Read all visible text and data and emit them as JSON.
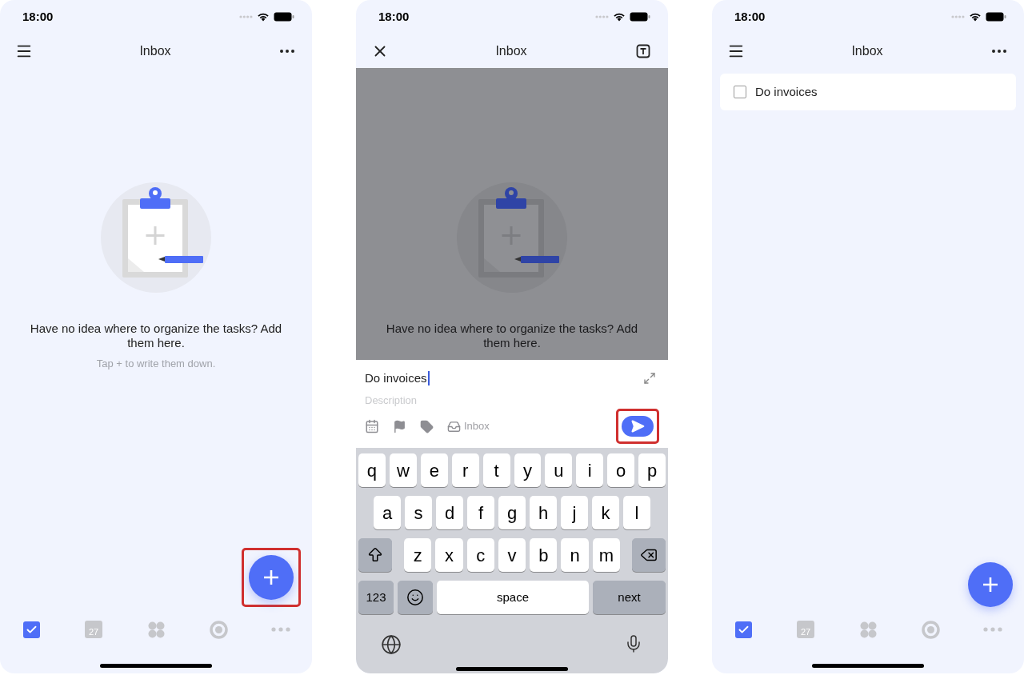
{
  "screens": [
    {
      "kind": "empty",
      "status_time": "18:00",
      "nav": {
        "left": {
          "kind": "menu"
        },
        "title": "Inbox",
        "right": {
          "kind": "more"
        }
      },
      "empty_state": {
        "message": "Have no idea where to organize the tasks? Add them here.",
        "hint": "Tap + to write them down."
      },
      "fab": {
        "highlighted": true
      },
      "tab_bar": [
        {
          "kind": "tasks",
          "selected": true
        },
        {
          "kind": "calendar",
          "label": "27",
          "selected": false
        },
        {
          "kind": "grid",
          "selected": false
        },
        {
          "kind": "focus",
          "selected": false
        },
        {
          "kind": "more",
          "selected": false
        }
      ]
    },
    {
      "kind": "compose",
      "status_time": "18:00",
      "nav": {
        "left": {
          "kind": "close"
        },
        "title": "Inbox",
        "right": {
          "kind": "template"
        }
      },
      "dimmed": true,
      "empty_state": {
        "message": "Have no idea where to organize the tasks? Add them here."
      },
      "compose": {
        "title": "Do invoices",
        "description_placeholder": "Description",
        "list_label": "Inbox",
        "send": {
          "highlighted": true
        }
      },
      "keyboard": {
        "rows": [
          {
            "keys": [
              {
                "kind": "letter",
                "label": "q"
              },
              {
                "kind": "letter",
                "label": "w"
              },
              {
                "kind": "letter",
                "label": "e"
              },
              {
                "kind": "letter",
                "label": "r"
              },
              {
                "kind": "letter",
                "label": "t"
              },
              {
                "kind": "letter",
                "label": "y"
              },
              {
                "kind": "letter",
                "label": "u"
              },
              {
                "kind": "letter",
                "label": "i"
              },
              {
                "kind": "letter",
                "label": "o"
              },
              {
                "kind": "letter",
                "label": "p"
              }
            ]
          },
          {
            "keys": [
              {
                "kind": "letter",
                "label": "a"
              },
              {
                "kind": "letter",
                "label": "s"
              },
              {
                "kind": "letter",
                "label": "d"
              },
              {
                "kind": "letter",
                "label": "f"
              },
              {
                "kind": "letter",
                "label": "g"
              },
              {
                "kind": "letter",
                "label": "h"
              },
              {
                "kind": "letter",
                "label": "j"
              },
              {
                "kind": "letter",
                "label": "k"
              },
              {
                "kind": "letter",
                "label": "l"
              }
            ]
          },
          {
            "keys": [
              {
                "kind": "shift"
              },
              {
                "kind": "letter",
                "label": "z"
              },
              {
                "kind": "letter",
                "label": "x"
              },
              {
                "kind": "letter",
                "label": "c"
              },
              {
                "kind": "letter",
                "label": "v"
              },
              {
                "kind": "letter",
                "label": "b"
              },
              {
                "kind": "letter",
                "label": "n"
              },
              {
                "kind": "letter",
                "label": "m"
              },
              {
                "kind": "delete"
              }
            ]
          },
          {
            "keys": [
              {
                "kind": "mode",
                "label": "123"
              },
              {
                "kind": "emoji"
              },
              {
                "kind": "space",
                "label": "space"
              },
              {
                "kind": "return",
                "label": "next"
              }
            ]
          }
        ]
      }
    },
    {
      "kind": "list",
      "status_time": "18:00",
      "nav": {
        "left": {
          "kind": "menu"
        },
        "title": "Inbox",
        "right": {
          "kind": "more"
        }
      },
      "tasks": [
        {
          "title": "Do invoices",
          "checked": false
        }
      ],
      "fab": {
        "highlighted": false
      },
      "tab_bar": [
        {
          "kind": "tasks",
          "selected": true
        },
        {
          "kind": "calendar",
          "label": "27",
          "selected": false
        },
        {
          "kind": "grid",
          "selected": false
        },
        {
          "kind": "focus",
          "selected": false
        },
        {
          "kind": "more",
          "selected": false
        }
      ]
    }
  ]
}
